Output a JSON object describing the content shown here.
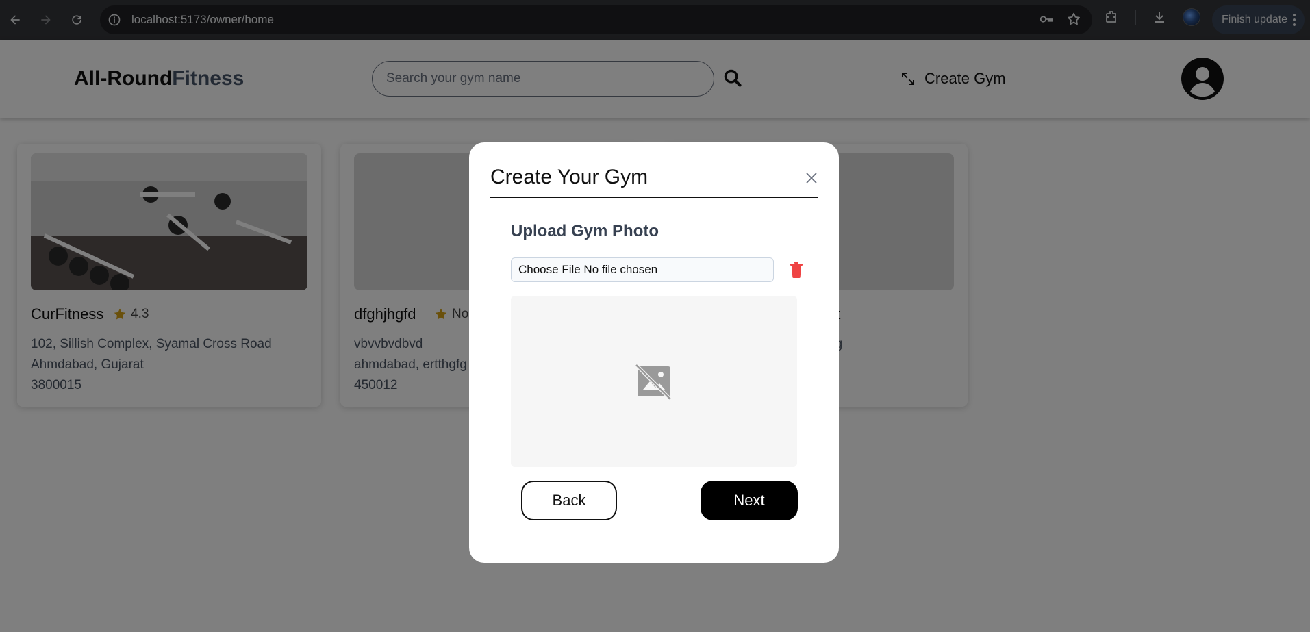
{
  "browser": {
    "url": "localhost:5173/owner/home",
    "finish_update_label": "Finish update"
  },
  "header": {
    "logo_main": "All-Round",
    "logo_accent": "Fitness",
    "search_placeholder": "Search your gym name",
    "create_gym_label": "Create Gym"
  },
  "cards": [
    {
      "name": "CurFitness",
      "rating": "4.3",
      "address_line1": "102, Sillish Complex, Syamal Cross Road",
      "address_line2": "Ahmdabad, Gujarat",
      "pincode": "3800015"
    },
    {
      "name": "dfghjhgfd",
      "rating": "No",
      "address_line1": "vbvvbvdbvd",
      "address_line2": "ahmdabad, ertthgfg",
      "pincode": "450012"
    },
    {
      "name_partial": "et",
      "address_partial": "dg"
    }
  ],
  "modal": {
    "title": "Create Your Gym",
    "section_title": "Upload Gym Photo",
    "file_input_text": "Choose File No file chosen",
    "back_label": "Back",
    "next_label": "Next"
  },
  "colors": {
    "star": "#d4a017",
    "trash": "#ef4444",
    "logo_accent": "#475569"
  }
}
